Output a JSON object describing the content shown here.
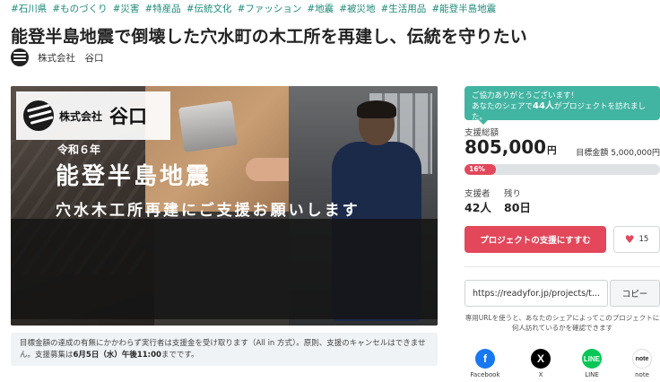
{
  "tags": [
    "#石川県",
    "#ものづくり",
    "#災害",
    "#特産品",
    "#伝統文化",
    "#ファッション",
    "#地震",
    "#被災地",
    "#生活用品",
    "#能登半島地震"
  ],
  "title": "能登半島地震で倒壊した穴水町の木工所を再建し、伝統を守りたい",
  "owner": {
    "name": "株式会社　谷口"
  },
  "hero": {
    "logo_company": "株式会社",
    "logo_name": "谷口",
    "era": "令和６年",
    "headline": "能登半島地震",
    "subline": "穴水木工所再建にご支援お願いします"
  },
  "notice": {
    "text_before": "目標金額の達成の有無にかかわらず実行者は支援金を受け取ります（All in 方式）。原則、支援のキャンセルはできません。支援募集は",
    "deadline": "6月5日（水）午後11:00",
    "text_after": "までです。"
  },
  "share_note": {
    "line1": "ご協力ありがとうございます！",
    "prefix": "あなたのシェアで",
    "count": "44人",
    "suffix": "がプロジェクトを訪れました。"
  },
  "funding": {
    "total_label": "支援総額",
    "amount": "805,000",
    "unit": "円",
    "goal_label": "目標金額",
    "goal_value": "5,000,000円",
    "progress_label": "16%",
    "progress_fraction": 0.16
  },
  "stats": {
    "supporters_label": "支援者",
    "supporters_value": "42人",
    "remaining_label": "残り",
    "remaining_value": "80日"
  },
  "actions": {
    "support_button": "プロジェクトの支援にすすむ",
    "like_count": "15"
  },
  "share": {
    "url": "https://readyfor.jp/projects/t...",
    "copy_button": "コピー",
    "note": "専用URLを使うと、あなたのシェアによってこのプロジェクトに何人訪れているかを確認できます"
  },
  "social": [
    {
      "name": "Facebook",
      "icon": "facebook-icon",
      "color": "#1877f2",
      "glyph": "f"
    },
    {
      "name": "X",
      "icon": "x-icon",
      "color": "#000000",
      "glyph": "X"
    },
    {
      "name": "LINE",
      "icon": "line-icon",
      "color": "#06c755",
      "glyph": "L"
    },
    {
      "name": "note",
      "icon": "note-icon",
      "color": "#ffffff",
      "glyph": "note"
    }
  ],
  "colors": {
    "accent": "#e2475a",
    "teal": "#41b4a2",
    "tag": "#1d8a78"
  }
}
